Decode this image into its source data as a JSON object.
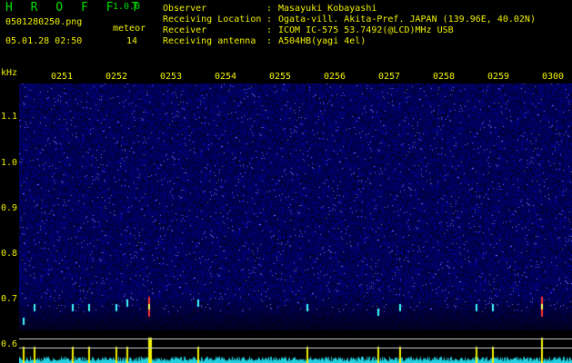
{
  "app": {
    "logo": "H R O F F T",
    "version": "1.0.0",
    "filename": "0501280250.png",
    "meteor_label": "meteor",
    "meteor_count": "14",
    "datetime": "05.01.28 02:50"
  },
  "info": [
    {
      "label": "Observer",
      "value": "Masayuki Kobayashi"
    },
    {
      "label": "Receiving Location",
      "value": "Ogata-vill. Akita-Pref. JAPAN (139.96E, 40.02N)"
    },
    {
      "label": "Receiver",
      "value": "ICOM IC-575 53.7492(@LCD)MHz USB"
    },
    {
      "label": "Receiving antenna",
      "value": "A504HB(yagi 4el)"
    }
  ],
  "colors": {
    "axis": "#f0f000",
    "title": "#00e000",
    "background": "#000000",
    "noise": "#1010a0"
  },
  "chart_data": {
    "type": "heatmap",
    "x_ticks": [
      "0251",
      "0252",
      "0253",
      "0254",
      "0255",
      "0256",
      "0257",
      "0258",
      "0259",
      "0300"
    ],
    "y_unit": "kHz",
    "y_ticks": [
      "1.1",
      "1.0",
      "0.9",
      "0.8",
      "0.7",
      "0.6"
    ],
    "y_tick_values": [
      1.1,
      1.0,
      0.9,
      0.8,
      0.7,
      0.6
    ],
    "meteor_marks": [
      {
        "time": "0250.3",
        "freq": 0.66
      },
      {
        "time": "0250.5",
        "freq": 0.69
      },
      {
        "time": "0251.2",
        "freq": 0.69
      },
      {
        "time": "0251.5",
        "freq": 0.69
      },
      {
        "time": "0252.0",
        "freq": 0.69
      },
      {
        "time": "0252.2",
        "freq": 0.7
      },
      {
        "time": "0252.6",
        "freq": 0.69
      },
      {
        "time": "0253.5",
        "freq": 0.7
      },
      {
        "time": "0255.5",
        "freq": 0.69
      },
      {
        "time": "0256.8",
        "freq": 0.68
      },
      {
        "time": "0257.2",
        "freq": 0.69
      },
      {
        "time": "0258.6",
        "freq": 0.69
      },
      {
        "time": "0258.9",
        "freq": 0.69
      },
      {
        "time": "0259.8",
        "freq": 0.69
      }
    ]
  }
}
